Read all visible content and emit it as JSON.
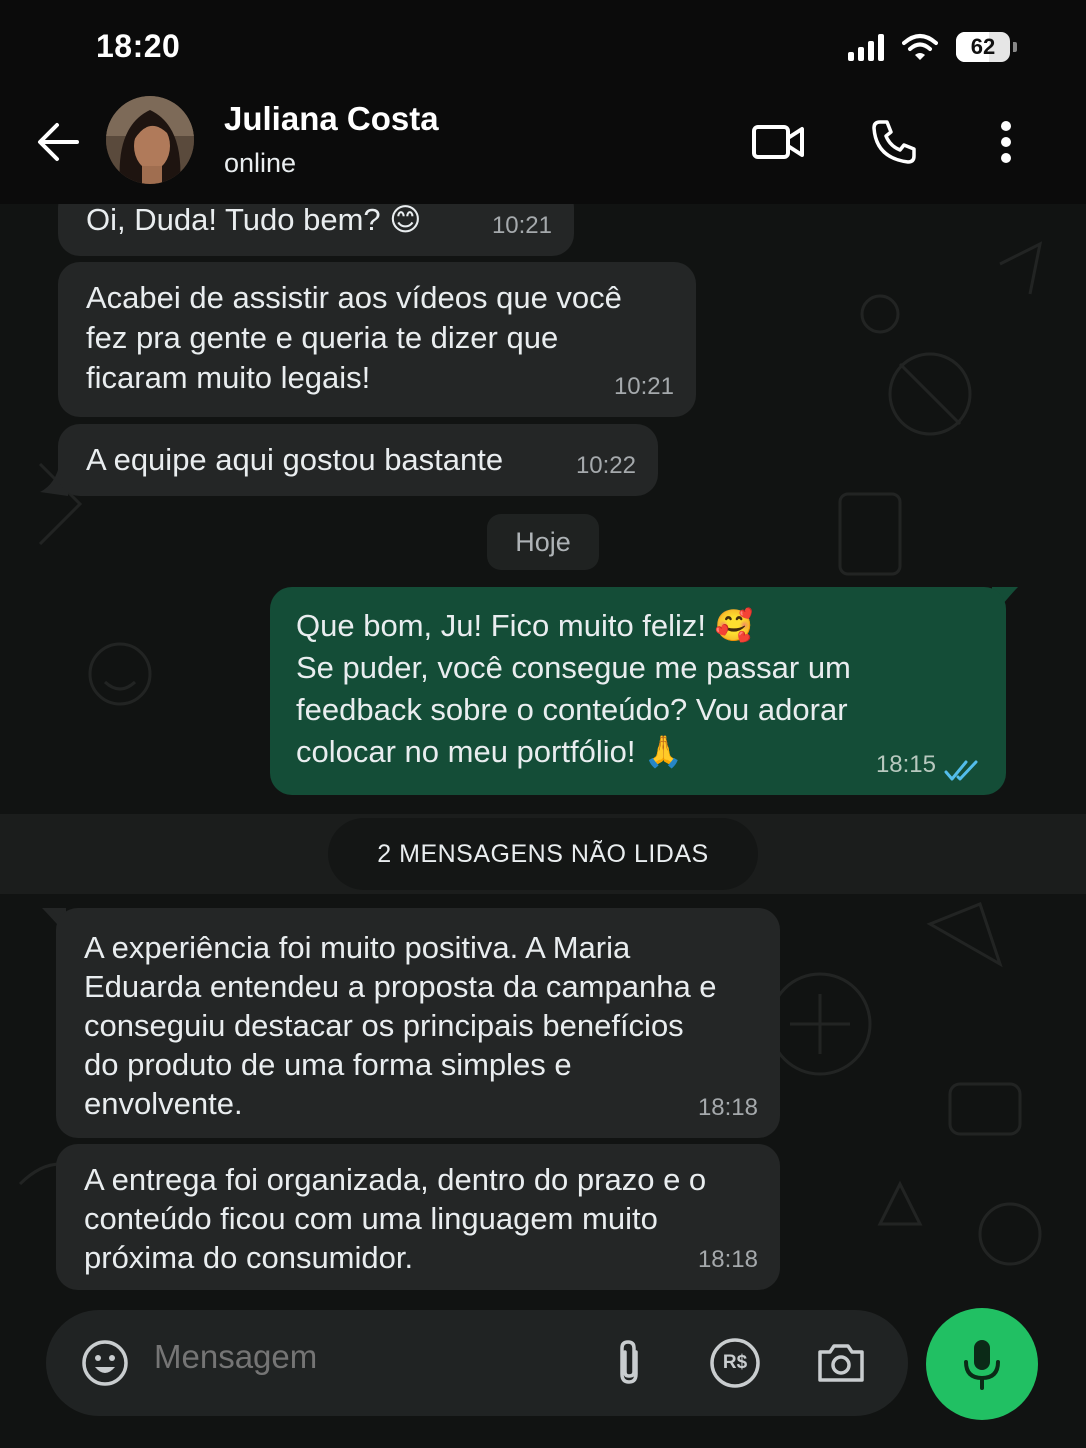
{
  "status_bar": {
    "time": "18:20",
    "battery": "62",
    "icons": [
      "signal-icon",
      "wifi-icon",
      "battery-icon"
    ]
  },
  "header": {
    "contact_name": "Juliana Costa",
    "contact_status": "online",
    "icons": [
      "back-arrow-icon",
      "video-call-icon",
      "phone-icon",
      "more-vertical-icon"
    ]
  },
  "messages_before": [
    {
      "direction": "in",
      "lines": [
        "Oi, Duda! Tudo bem? 😊"
      ],
      "time": "10:21"
    },
    {
      "direction": "in",
      "lines": [
        "Acabei de assistir aos vídeos que você",
        "fez pra gente e queria te dizer que",
        "ficaram muito legais!"
      ],
      "time": "10:21"
    },
    {
      "direction": "in",
      "lines": [
        "A equipe aqui gostou bastante"
      ],
      "time": "10:22"
    }
  ],
  "date_separator": "Hoje",
  "message_out": {
    "direction": "out",
    "lines": [
      "Que bom, Ju! Fico muito feliz! 🥰",
      "Se puder, você consegue me passar um",
      "feedback sobre o conteúdo? Vou adorar",
      "colocar no meu portfólio! 🙏"
    ],
    "time": "18:15",
    "status": "read"
  },
  "unread_separator": "2 MENSAGENS NÃO LIDAS",
  "messages_after": [
    {
      "direction": "in",
      "lines": [
        "A experiência foi muito positiva. A Maria",
        "Eduarda entendeu a proposta da campanha e",
        "conseguiu destacar os principais benefícios",
        "do produto de uma forma simples e",
        "envolvente."
      ],
      "time": "18:18"
    },
    {
      "direction": "in",
      "lines": [
        "A entrega foi organizada, dentro do prazo e o",
        "conteúdo ficou com uma linguagem muito",
        "próxima do consumidor."
      ],
      "time": "18:18"
    }
  ],
  "composer": {
    "placeholder": "Mensagem",
    "icons": [
      "emoji-icon",
      "attach-icon",
      "payment-icon",
      "camera-icon",
      "mic-icon"
    ],
    "payment_label": "R$"
  },
  "colors": {
    "incoming_bubble": "#242626",
    "outgoing_bubble": "#144d37",
    "accent_green": "#21c063",
    "read_ticks": "#53bdeb",
    "chat_background": "#111312"
  }
}
